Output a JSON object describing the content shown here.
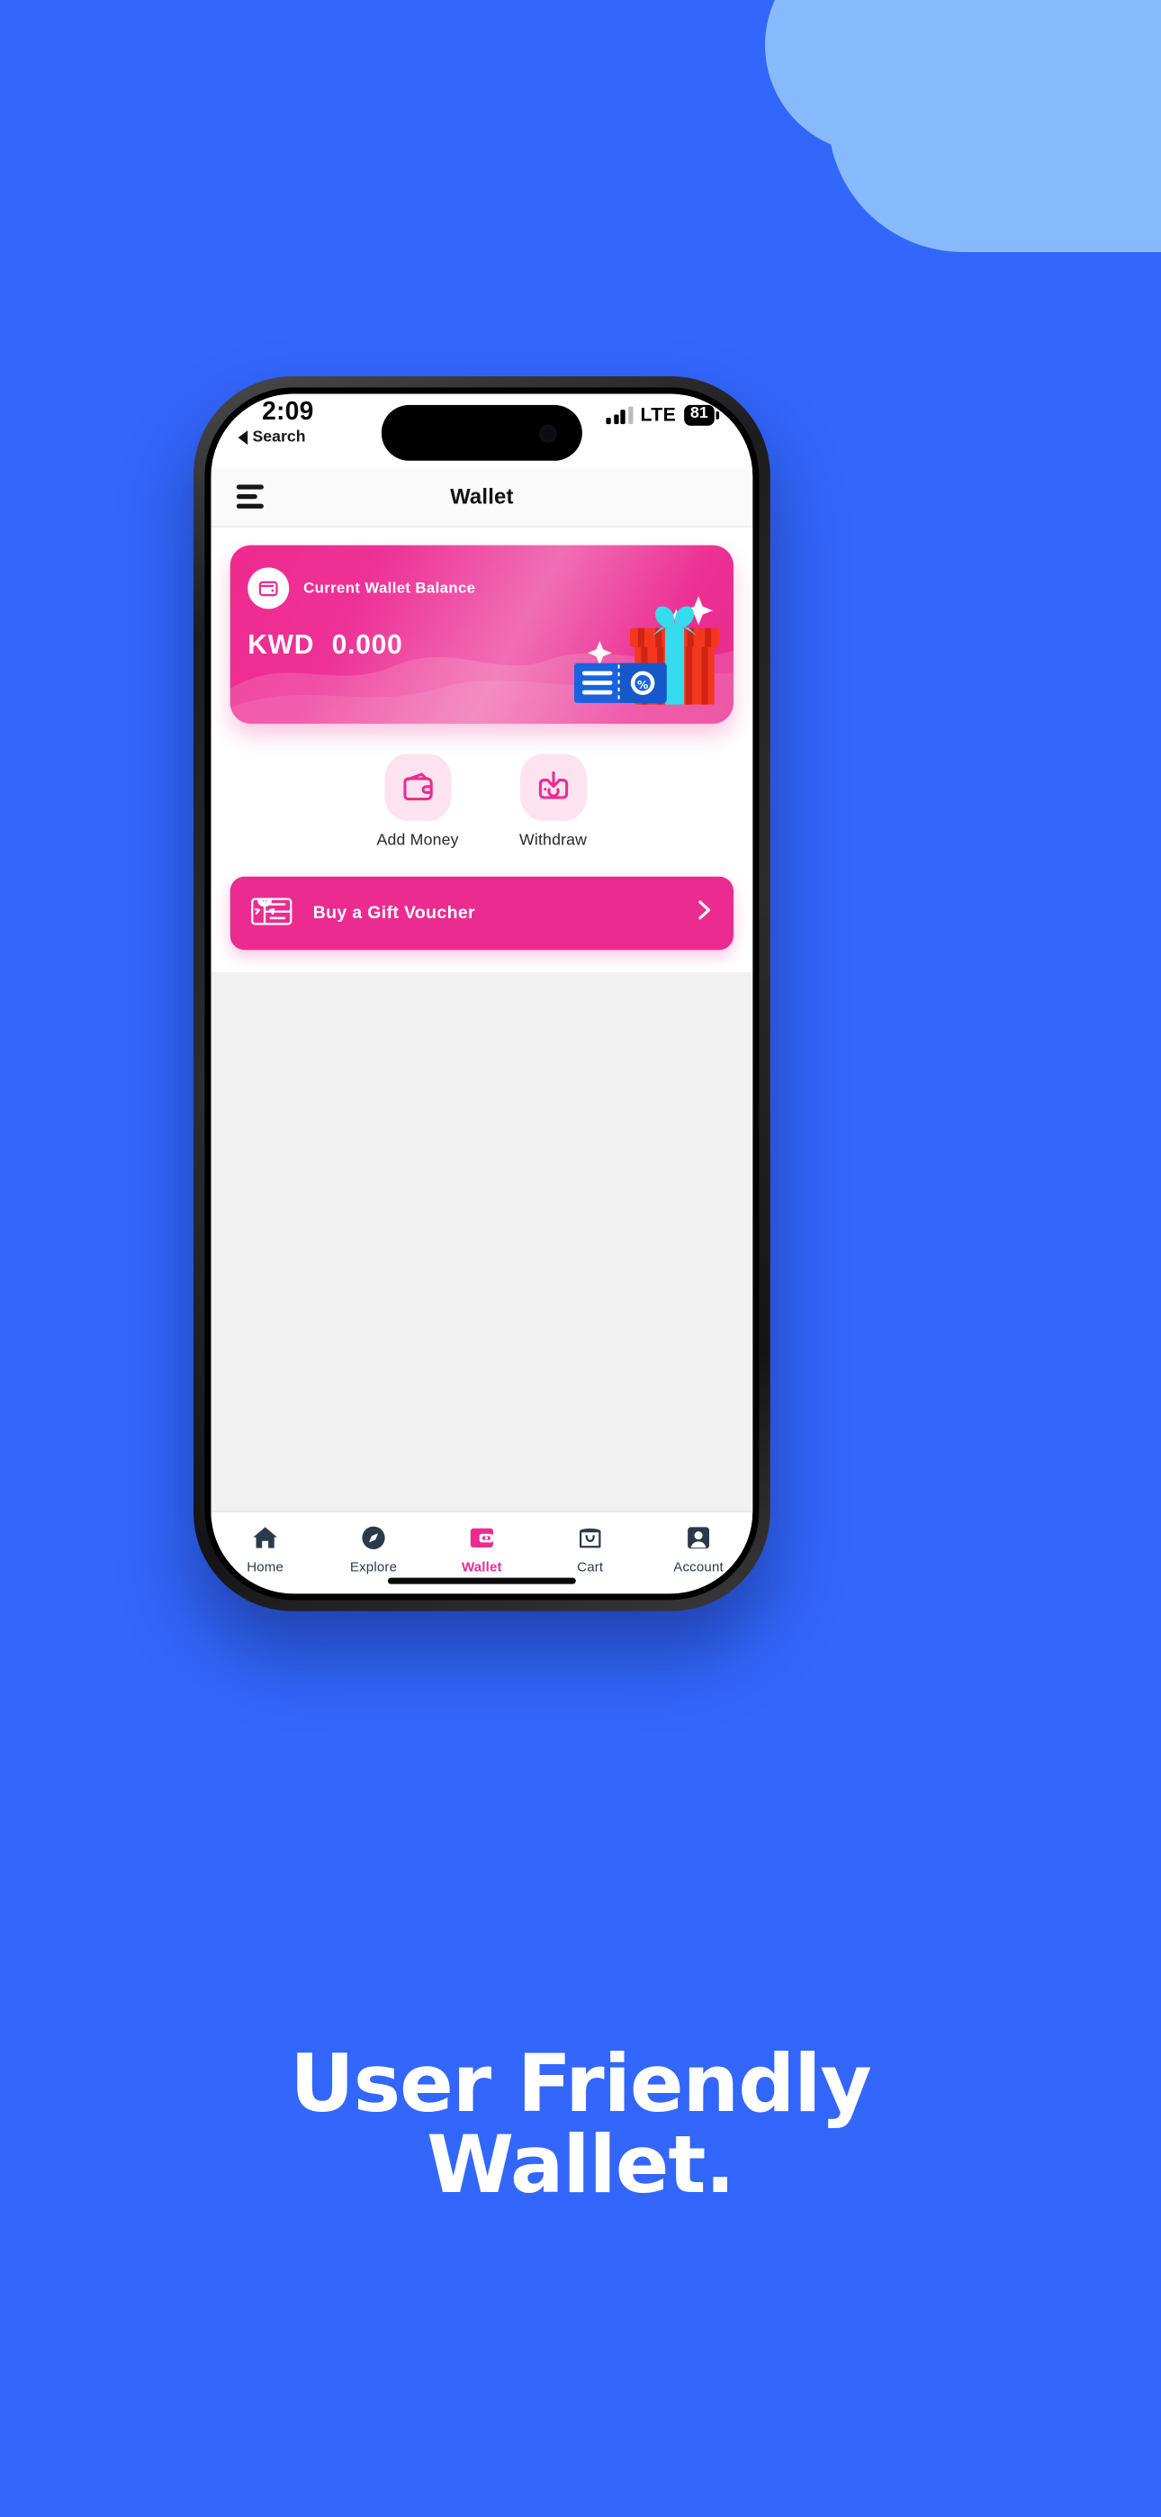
{
  "background": {
    "color": "#3366FB",
    "cloud_color": "#86BAFD",
    "cloud_icon": "cloud-shape"
  },
  "device": {
    "frame_color": "#1d1d1f",
    "home_indicator": "home-indicator"
  },
  "status_bar": {
    "time": "2:09",
    "back_label": "Search",
    "back_icon": "triangle-left-icon",
    "signal_icon": "signal-bars-icon",
    "network": "LTE",
    "battery_level": "81",
    "battery_icon": "battery-icon",
    "camera_icon": "front-camera-icon"
  },
  "header": {
    "menu_icon": "hamburger-menu-icon",
    "title": "Wallet"
  },
  "balance_card": {
    "icon": "wallet-icon",
    "label": "Current Wallet Balance",
    "currency": "KWD",
    "amount": "0.000",
    "illustration": "gift-box-and-voucher-illustration",
    "gradient_from": "#ef2a8f",
    "gradient_to": "#f06eb4"
  },
  "quick_actions": [
    {
      "icon": "wallet-add-icon",
      "label": "Add Money"
    },
    {
      "icon": "withdraw-download-icon",
      "label": "Withdraw"
    }
  ],
  "gift_voucher": {
    "icon": "gift-card-icon",
    "label": "Buy a Gift Voucher",
    "chevron_icon": "chevron-right-icon",
    "accent": "#ec2b90"
  },
  "bottom_nav": {
    "active": "Wallet",
    "items": [
      {
        "icon": "home-icon",
        "label": "Home",
        "active": false
      },
      {
        "icon": "compass-icon",
        "label": "Explore",
        "active": false
      },
      {
        "icon": "wallet-icon",
        "label": "Wallet",
        "active": true
      },
      {
        "icon": "cart-bag-icon",
        "label": "Cart",
        "active": false
      },
      {
        "icon": "account-person-icon",
        "label": "Account",
        "active": false
      }
    ]
  },
  "marketing": {
    "line1": "User Friendly",
    "line2": "Wallet."
  }
}
